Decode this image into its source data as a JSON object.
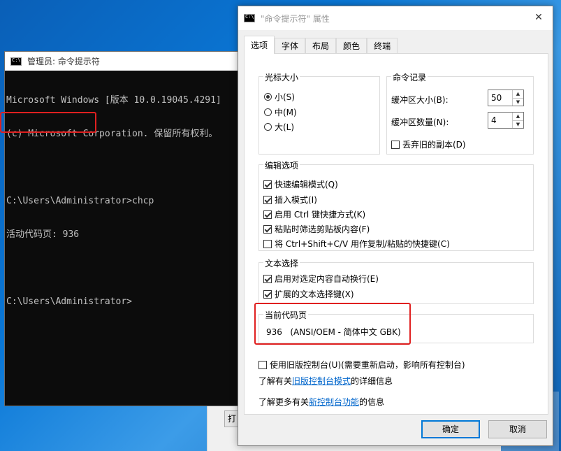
{
  "background": {
    "partial_button_label": "打"
  },
  "console": {
    "title": "管理员: 命令提示符",
    "lines": [
      "Microsoft Windows [版本 10.0.19045.4291]",
      "(c) Microsoft Corporation. 保留所有权利。",
      "",
      "C:\\Users\\Administrator>chcp",
      "活动代码页: 936",
      "",
      "C:\\Users\\Administrator>"
    ]
  },
  "dialog": {
    "title": "\"命令提示符\" 属性",
    "close_glyph": "✕",
    "tabs": [
      "选项",
      "字体",
      "布局",
      "颜色",
      "终端"
    ],
    "cursor_size": {
      "legend": "光标大小",
      "options": [
        {
          "label": "小(S)",
          "checked": true
        },
        {
          "label": "中(M)",
          "checked": false
        },
        {
          "label": "大(L)",
          "checked": false
        }
      ]
    },
    "history": {
      "legend": "命令记录",
      "buffer_size_label": "缓冲区大小(B):",
      "buffer_size_value": "50",
      "buffer_count_label": "缓冲区数量(N):",
      "buffer_count_value": "4",
      "discard_label": "丢弃旧的副本(D)",
      "discard_checked": false
    },
    "edit_options": {
      "legend": "编辑选项",
      "items": [
        {
          "label": "快速编辑模式(Q)",
          "checked": true
        },
        {
          "label": "插入模式(I)",
          "checked": true
        },
        {
          "label": "启用 Ctrl 键快捷方式(K)",
          "checked": true
        },
        {
          "label": "粘贴时筛选剪贴板内容(F)",
          "checked": true
        },
        {
          "label": "将 Ctrl+Shift+C/V 用作复制/粘贴的快捷键(C)",
          "checked": false
        }
      ]
    },
    "text_selection": {
      "legend": "文本选择",
      "items": [
        {
          "label": "启用对选定内容自动换行(E)",
          "checked": true
        },
        {
          "label": "扩展的文本选择键(X)",
          "checked": true
        }
      ]
    },
    "codepage": {
      "legend": "当前代码页",
      "value": "936   (ANSI/OEM - 简体中文 GBK)"
    },
    "legacy": {
      "label": "使用旧版控制台(U)(需要重新启动，影响所有控制台)",
      "checked": false,
      "learn_prefix": "了解有关",
      "learn_link": "旧版控制台模式",
      "learn_suffix": "的详细信息",
      "more_prefix": "了解更多有关",
      "more_link": "新控制台功能",
      "more_suffix": "的信息"
    },
    "buttons": {
      "ok": "确定",
      "cancel": "取消"
    }
  }
}
